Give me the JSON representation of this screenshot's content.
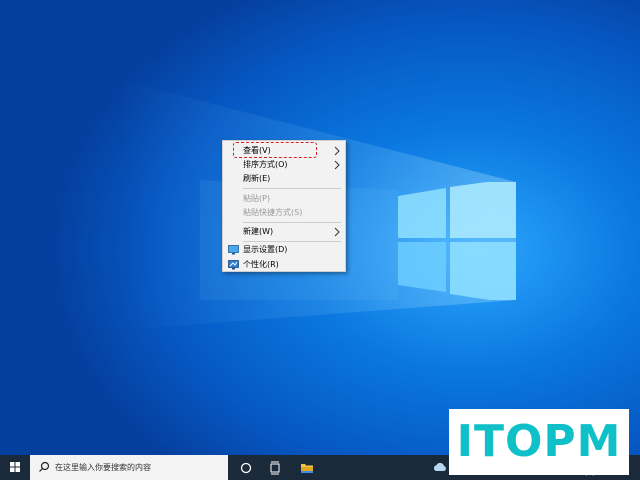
{
  "context_menu": {
    "items": [
      {
        "label": "查看(V)",
        "has_submenu": true,
        "enabled": true
      },
      {
        "label": "排序方式(O)",
        "has_submenu": true,
        "enabled": true
      },
      {
        "label": "刷新(E)",
        "has_submenu": false,
        "enabled": true
      },
      {
        "label": "粘贴(P)",
        "has_submenu": false,
        "enabled": false
      },
      {
        "label": "粘贴快捷方式(S)",
        "has_submenu": false,
        "enabled": false
      },
      {
        "label": "新建(W)",
        "has_submenu": true,
        "enabled": true
      },
      {
        "label": "显示设置(D)",
        "has_submenu": false,
        "enabled": true,
        "icon": "display-settings-icon"
      },
      {
        "label": "个性化(R)",
        "has_submenu": false,
        "enabled": true,
        "icon": "personalize-icon"
      }
    ],
    "highlighted_item": "查看(V)"
  },
  "taskbar": {
    "search_placeholder": "在这里输入你要搜索的内容",
    "clock_date": "2022/3/7",
    "icons": [
      "windows-start-icon",
      "search-icon",
      "cortana-circle-icon",
      "task-view-icon",
      "file-explorer-icon",
      "weather-cloud-icon"
    ]
  },
  "watermark": {
    "text": "ITOPM"
  },
  "colors": {
    "desktop_blue": "#0a78e0",
    "taskbar": "#1b2a3b",
    "highlight_dash": "#d42222",
    "watermark": "#0fc0c8"
  }
}
